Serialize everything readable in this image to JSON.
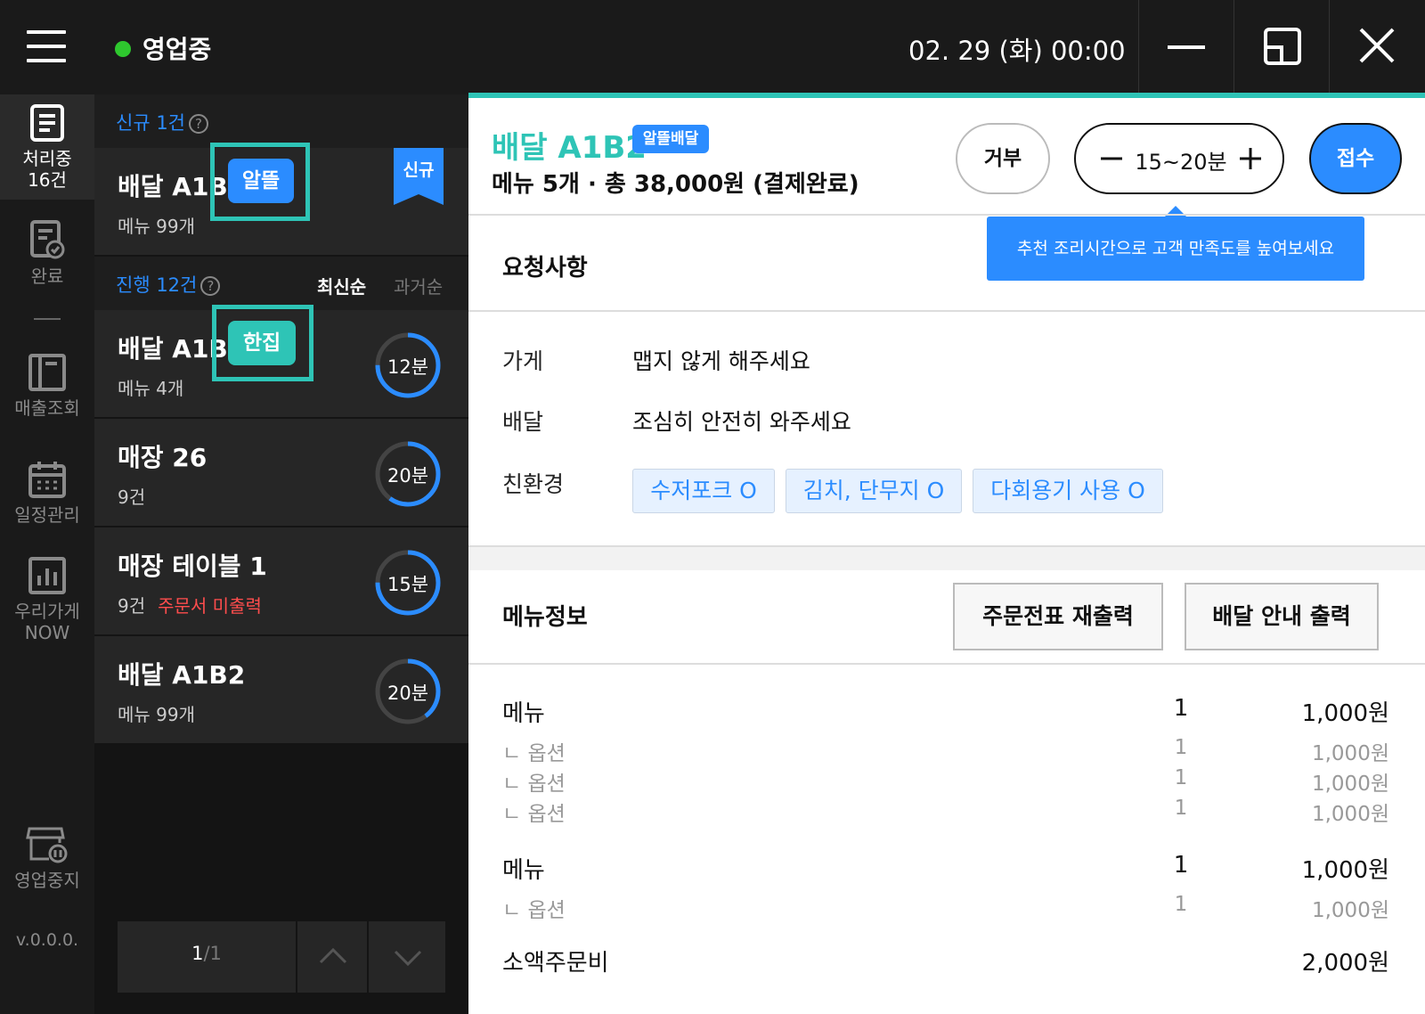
{
  "topbar": {
    "status": "영업중",
    "datetime": "02. 29 (화) 00:00"
  },
  "sidebar": {
    "items": [
      {
        "label": "처리중",
        "label2": "16건"
      },
      {
        "label": "완료"
      },
      {
        "label": "매출조회"
      },
      {
        "label": "일정관리"
      },
      {
        "label": "우리가게",
        "label2": "NOW"
      },
      {
        "label": "영업중지"
      }
    ],
    "version": "v.0.0.0."
  },
  "orders": {
    "new_header": "신규 1건",
    "new_card": {
      "title": "배달 A1B2",
      "subtitle": "메뉴 99개",
      "ribbon": "신규",
      "badge": "알뜰"
    },
    "progress_header": "진행 12건",
    "sort_latest": "최신순",
    "sort_oldest": "과거순",
    "cards": [
      {
        "title": "배달 A1B2",
        "subtitle": "메뉴 4개",
        "time": "12분",
        "badge": "한집",
        "progress": 0.75
      },
      {
        "title": "매장 26",
        "subtitle": "9건",
        "time": "20분",
        "progress": 0.6
      },
      {
        "title": "매장 테이블 1",
        "subtitle": "9건",
        "warning": "주문서 미출력",
        "time": "15분",
        "progress": 0.75
      },
      {
        "title": "배달 A1B2",
        "subtitle": "메뉴 99개",
        "time": "20분",
        "progress": 0.4
      }
    ],
    "pager": {
      "current": "1",
      "total": "/1"
    }
  },
  "detail": {
    "title": "배달 A1B2",
    "type_badge": "알뜰배달",
    "summary": "메뉴 5개 · 총 38,000원 (결제완료)",
    "reject_label": "거부",
    "time_range": "15~20분",
    "accept_label": "접수",
    "tooltip": "추천 조리시간으로 고객 만족도를 높여보세요",
    "requests_title": "요청사항",
    "requests": [
      {
        "key": "가게",
        "value": "맵지 않게 해주세요"
      },
      {
        "key": "배달",
        "value": "조심히 안전히 와주세요"
      }
    ],
    "eco_key": "친환경",
    "eco_chips": [
      "수저포크 O",
      "김치, 단무지 O",
      "다회용기 사용 O"
    ],
    "menu_title": "메뉴정보",
    "reprint_label": "주문전표 재출력",
    "delivery_print_label": "배달 안내 출력",
    "menu_rows": [
      {
        "name": "메뉴",
        "qty": "1",
        "price": "1,000원"
      },
      {
        "name": "ㄴ 옵션",
        "qty": "1",
        "price": "1,000원"
      },
      {
        "name": "ㄴ 옵션",
        "qty": "1",
        "price": "1,000원"
      },
      {
        "name": "ㄴ 옵션",
        "qty": "1",
        "price": "1,000원"
      },
      {
        "name": "메뉴",
        "qty": "1",
        "price": "1,000원"
      },
      {
        "name": "ㄴ 옵션",
        "qty": "1",
        "price": "1,000원"
      }
    ],
    "small_order_fee_label": "소액주문비",
    "small_order_fee": "2,000원"
  },
  "colors": {
    "accent": "#2b8cff",
    "teal": "#2ec4b6",
    "status_on": "#2ec82e",
    "warning": "#ff4d4d"
  }
}
